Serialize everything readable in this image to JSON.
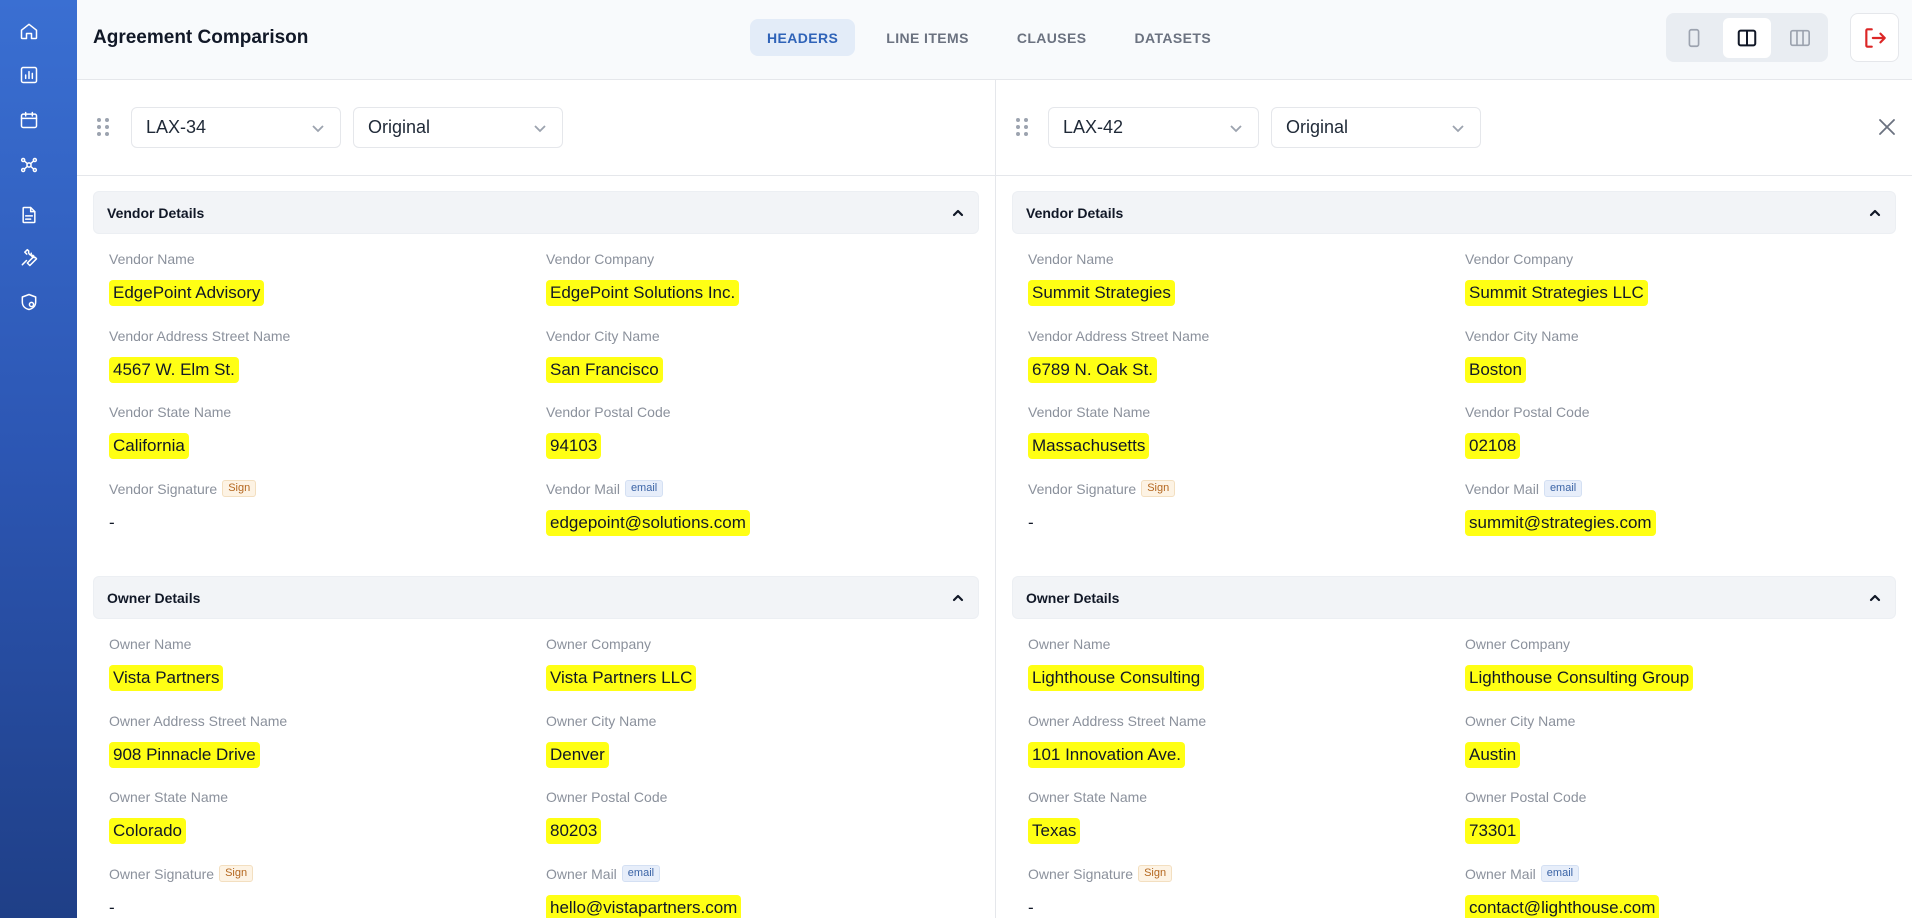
{
  "app": {
    "title": "Agreement Comparison"
  },
  "tabs": [
    {
      "label": "HEADERS",
      "active": true
    },
    {
      "label": "LINE ITEMS",
      "active": false
    },
    {
      "label": "CLAUSES",
      "active": false
    },
    {
      "label": "DATASETS",
      "active": false
    }
  ],
  "sidebar": {
    "icons": [
      "home-icon",
      "chart-icon",
      "calendar-icon",
      "network-icon",
      "document-icon",
      "wrench-icon",
      "shield-settings-icon"
    ]
  },
  "layout_switch": {
    "options": [
      "single-pane-icon",
      "two-pane-icon",
      "three-pane-icon"
    ],
    "selected": "two-pane-icon"
  },
  "colors": {
    "highlight": "#ffff14",
    "accent": "#2f63b8",
    "logout": "#dc2626",
    "sidebar": "#2c56b3"
  },
  "left": {
    "agreement": "LAX-34",
    "version": "Original",
    "vendor": {
      "title": "Vendor Details",
      "name_label": "Vendor Name",
      "name": "EdgePoint Advisory",
      "company_label": "Vendor Company",
      "company": "EdgePoint Solutions Inc.",
      "street_label": "Vendor Address Street Name",
      "street": "4567 W. Elm St.",
      "city_label": "Vendor City Name",
      "city": "San Francisco",
      "state_label": "Vendor State Name",
      "state": "California",
      "postal_label": "Vendor Postal Code",
      "postal": "94103",
      "signature_label": "Vendor Signature",
      "signature_tag": "Sign",
      "signature": "-",
      "mail_label": "Vendor Mail",
      "mail_tag": "email",
      "mail": "edgepoint@solutions.com"
    },
    "owner": {
      "title": "Owner Details",
      "name_label": "Owner Name",
      "name": "Vista Partners",
      "company_label": "Owner Company",
      "company": "Vista Partners LLC",
      "street_label": "Owner Address Street Name",
      "street": "908 Pinnacle Drive",
      "city_label": "Owner City Name",
      "city": "Denver",
      "state_label": "Owner State Name",
      "state": "Colorado",
      "postal_label": "Owner Postal Code",
      "postal": "80203",
      "signature_label": "Owner Signature",
      "signature_tag": "Sign",
      "signature": "-",
      "mail_label": "Owner Mail",
      "mail_tag": "email",
      "mail": "hello@vistapartners.com"
    }
  },
  "right": {
    "agreement": "LAX-42",
    "version": "Original",
    "vendor": {
      "title": "Vendor Details",
      "name_label": "Vendor Name",
      "name": "Summit Strategies",
      "company_label": "Vendor Company",
      "company": "Summit Strategies LLC",
      "street_label": "Vendor Address Street Name",
      "street": "6789 N. Oak St.",
      "city_label": "Vendor City Name",
      "city": "Boston",
      "state_label": "Vendor State Name",
      "state": "Massachusetts",
      "postal_label": "Vendor Postal Code",
      "postal": "02108",
      "signature_label": "Vendor Signature",
      "signature_tag": "Sign",
      "signature": "-",
      "mail_label": "Vendor Mail",
      "mail_tag": "email",
      "mail": "summit@strategies.com"
    },
    "owner": {
      "title": "Owner Details",
      "name_label": "Owner Name",
      "name": "Lighthouse Consulting",
      "company_label": "Owner Company",
      "company": "Lighthouse Consulting Group",
      "street_label": "Owner Address Street Name",
      "street": "101 Innovation Ave.",
      "city_label": "Owner City Name",
      "city": "Austin",
      "state_label": "Owner State Name",
      "state": "Texas",
      "postal_label": "Owner Postal Code",
      "postal": "73301",
      "signature_label": "Owner Signature",
      "signature_tag": "Sign",
      "signature": "-",
      "mail_label": "Owner Mail",
      "mail_tag": "email",
      "mail": "contact@lighthouse.com"
    }
  }
}
